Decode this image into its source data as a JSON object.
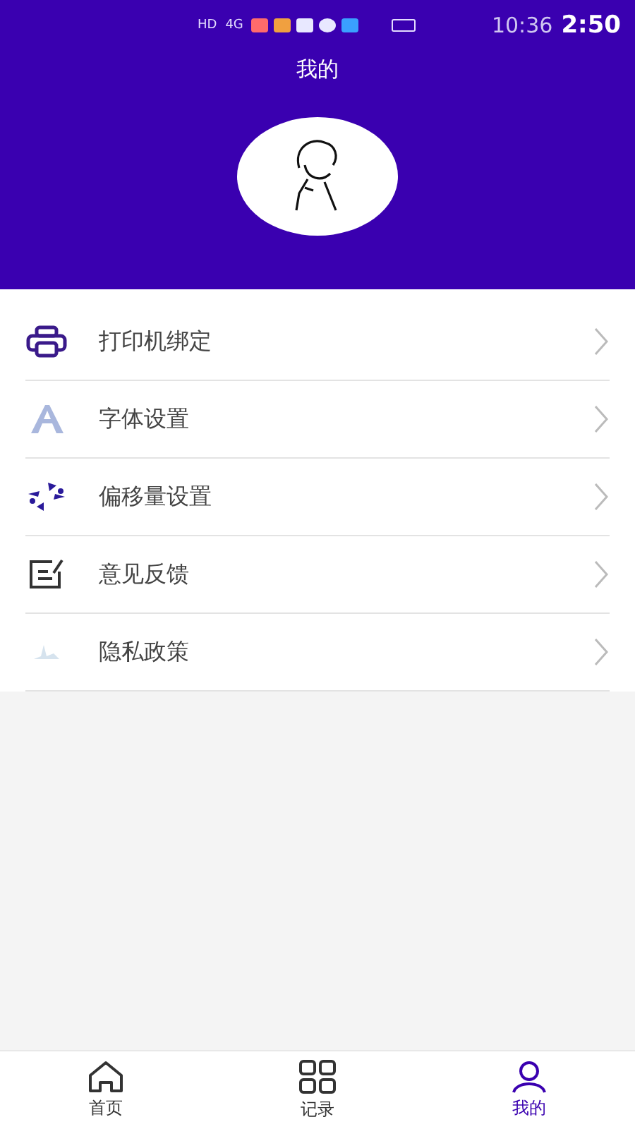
{
  "status_bar": {
    "badges": [
      "HD",
      "4G"
    ],
    "time": "10:36",
    "overlay_time": "2:50"
  },
  "header": {
    "title": "我的"
  },
  "menu": [
    {
      "kind": "printer",
      "label": "打印机绑定"
    },
    {
      "kind": "font",
      "label": "字体设置"
    },
    {
      "kind": "offset",
      "label": "偏移量设置"
    },
    {
      "kind": "feedback",
      "label": "意见反馈"
    },
    {
      "kind": "privacy",
      "label": "隐私政策"
    }
  ],
  "tabs": [
    {
      "kind": "home",
      "label": "首页",
      "selected": false
    },
    {
      "kind": "records",
      "label": "记录",
      "selected": false
    },
    {
      "kind": "me",
      "label": "我的",
      "selected": true
    }
  ]
}
